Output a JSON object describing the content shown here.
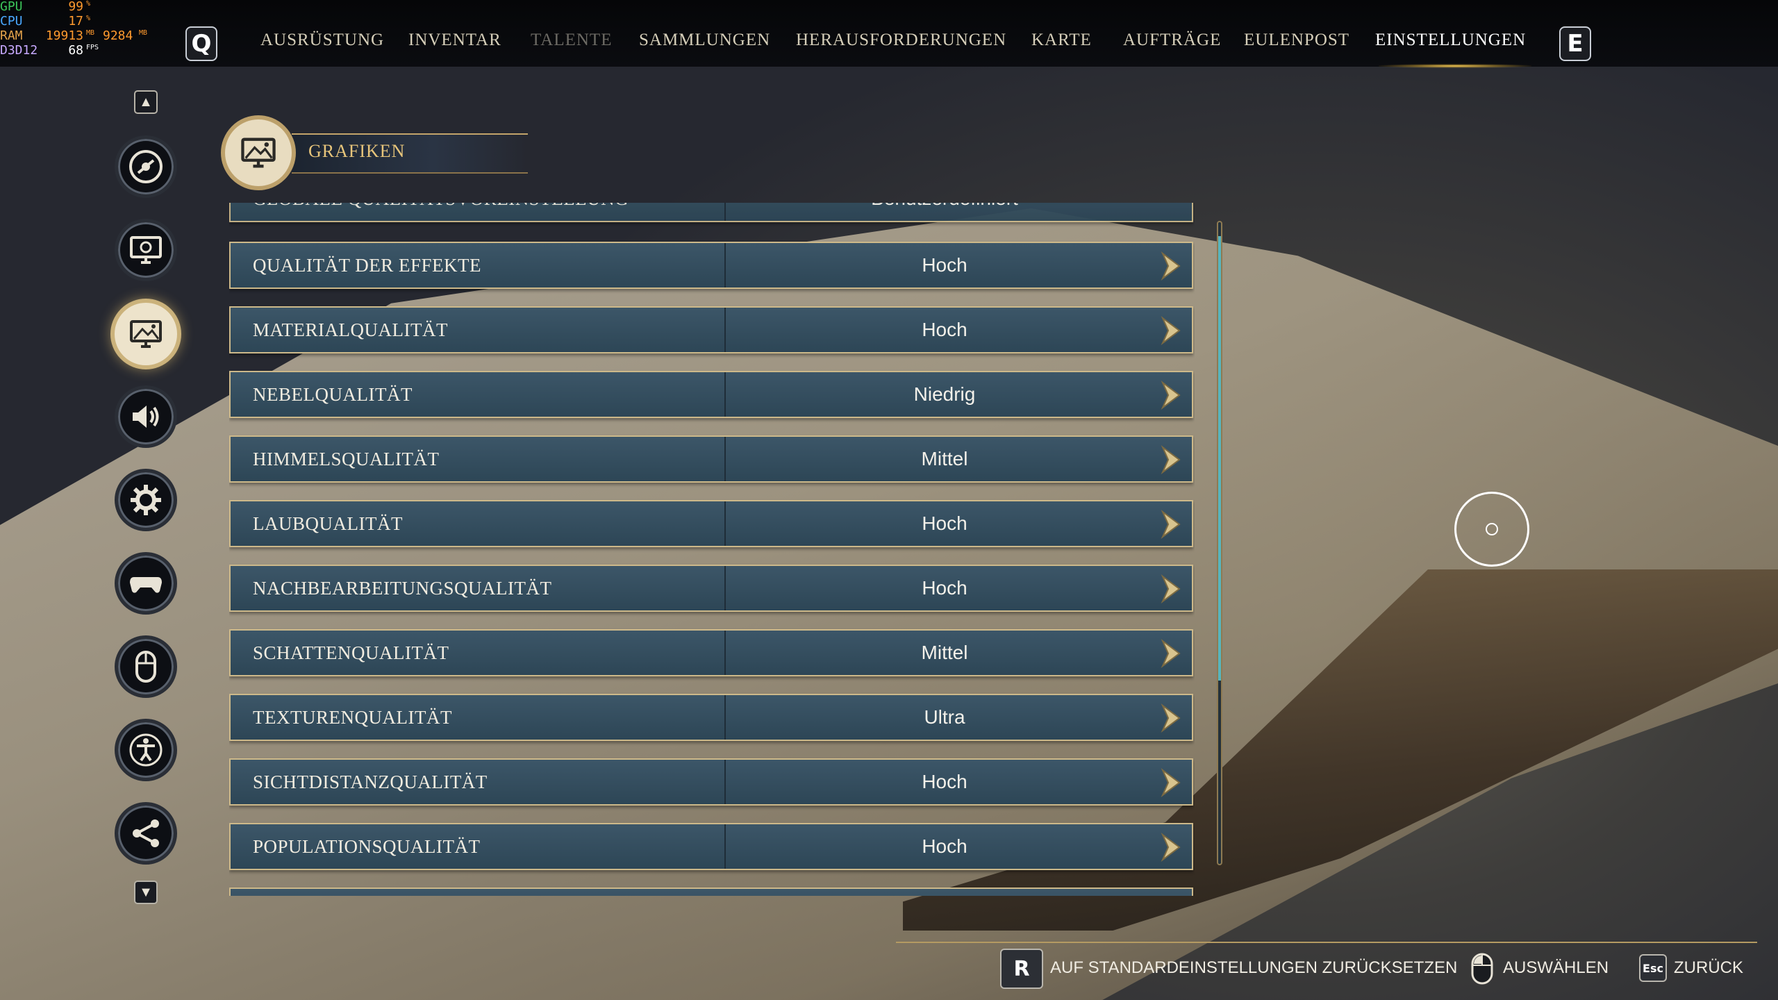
{
  "hud": {
    "gpu": {
      "label": "GPU",
      "value": "99",
      "unit": "%"
    },
    "cpu": {
      "label": "CPU",
      "value": "17",
      "unit": "%"
    },
    "ram": {
      "label": "RAM",
      "value": "19913",
      "unit": "MB",
      "extra": "9284",
      "extra_unit": "MB"
    },
    "d3d": {
      "label": "D3D12",
      "value": "68",
      "unit": "FPS"
    }
  },
  "topnav": {
    "left_key": "Q",
    "right_key": "E",
    "items": [
      {
        "label": "AUSRÜSTUNG",
        "state": "normal"
      },
      {
        "label": "INVENTAR",
        "state": "normal"
      },
      {
        "label": "TALENTE",
        "state": "disabled"
      },
      {
        "label": "SAMMLUNGEN",
        "state": "normal"
      },
      {
        "label": "HERAUSFORDERUNGEN",
        "state": "normal"
      },
      {
        "label": "KARTE",
        "state": "normal"
      },
      {
        "label": "AUFTRÄGE",
        "state": "normal"
      },
      {
        "label": "EULENPOST",
        "state": "normal"
      },
      {
        "label": "EINSTELLUNGEN",
        "state": "active"
      }
    ]
  },
  "sidebar": {
    "up_arrow": "▲",
    "down_arrow": "▼",
    "icons": [
      "disc-icon",
      "display-settings-icon",
      "graphics-icon",
      "audio-icon",
      "gameplay-gear-icon",
      "controller-icon",
      "mouse-icon",
      "accessibility-icon",
      "share-icon"
    ],
    "active_index": 2
  },
  "section": {
    "title": "GRAFIKEN"
  },
  "settings": {
    "partial_top": {
      "label": "GLOBALE QUALITÄTSVOREINSTELLUNG",
      "value": "Benutzerdefiniert"
    },
    "rows": [
      {
        "label": "QUALITÄT DER EFFEKTE",
        "value": "Hoch"
      },
      {
        "label": "MATERIALQUALITÄT",
        "value": "Hoch"
      },
      {
        "label": "NEBELQUALITÄT",
        "value": "Niedrig"
      },
      {
        "label": "HIMMELSQUALITÄT",
        "value": "Mittel"
      },
      {
        "label": "LAUBQUALITÄT",
        "value": "Hoch"
      },
      {
        "label": "NACHBEARBEITUNGSQUALITÄT",
        "value": "Hoch"
      },
      {
        "label": "SCHATTENQUALITÄT",
        "value": "Mittel"
      },
      {
        "label": "TEXTURENQUALITÄT",
        "value": "Ultra"
      },
      {
        "label": "SICHTDISTANZQUALITÄT",
        "value": "Hoch"
      },
      {
        "label": "POPULATIONSQUALITÄT",
        "value": "Hoch"
      }
    ]
  },
  "footer": {
    "reset_key": "R",
    "reset_label": "AUF STANDARDEINSTELLUNGEN ZURÜCKSETZEN",
    "select_label": "AUSWÄHLEN",
    "back_key": "Esc",
    "back_label": "ZURÜCK"
  },
  "colors": {
    "accent_gold": "#cdb98a",
    "row_blue": "#34505f",
    "scroll_teal": "#57b5bd"
  }
}
